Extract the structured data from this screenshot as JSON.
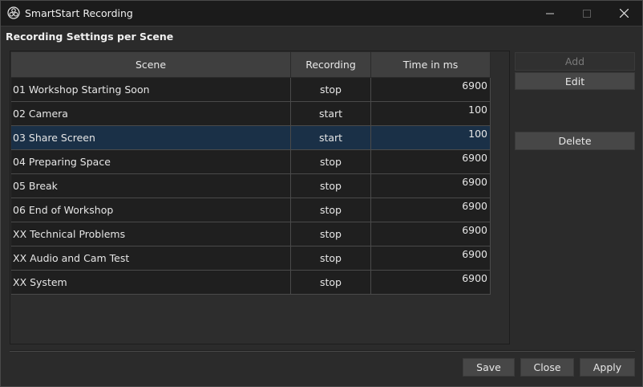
{
  "window": {
    "title": "SmartStart Recording",
    "icons": {
      "app": "obs-logo-icon",
      "minimize": "minimize-icon",
      "maximize": "maximize-icon",
      "close": "close-icon"
    }
  },
  "heading": "Recording Settings per Scene",
  "table": {
    "columns": [
      "Scene",
      "Recording",
      "Time in ms"
    ],
    "rows": [
      {
        "scene": "01 Workshop Starting Soon",
        "recording": "stop",
        "time": "6900",
        "selected": false
      },
      {
        "scene": "02 Camera",
        "recording": "start",
        "time": "100",
        "selected": false
      },
      {
        "scene": "03 Share Screen",
        "recording": "start",
        "time": "100",
        "selected": true
      },
      {
        "scene": "04 Preparing Space",
        "recording": "stop",
        "time": "6900",
        "selected": false
      },
      {
        "scene": "05 Break",
        "recording": "stop",
        "time": "6900",
        "selected": false
      },
      {
        "scene": "06 End of Workshop",
        "recording": "stop",
        "time": "6900",
        "selected": false
      },
      {
        "scene": "XX Technical Problems",
        "recording": "stop",
        "time": "6900",
        "selected": false
      },
      {
        "scene": "XX Audio and Cam Test",
        "recording": "stop",
        "time": "6900",
        "selected": false
      },
      {
        "scene": "XX System",
        "recording": "stop",
        "time": "6900",
        "selected": false
      }
    ]
  },
  "side_buttons": {
    "add": "Add",
    "edit": "Edit",
    "delete": "Delete",
    "add_disabled": true
  },
  "footer_buttons": {
    "save": "Save",
    "close": "Close",
    "apply": "Apply"
  },
  "colors": {
    "selected_row": "#1a3047",
    "titlebar": "#1b1b1b",
    "background": "#2b2b2b"
  }
}
